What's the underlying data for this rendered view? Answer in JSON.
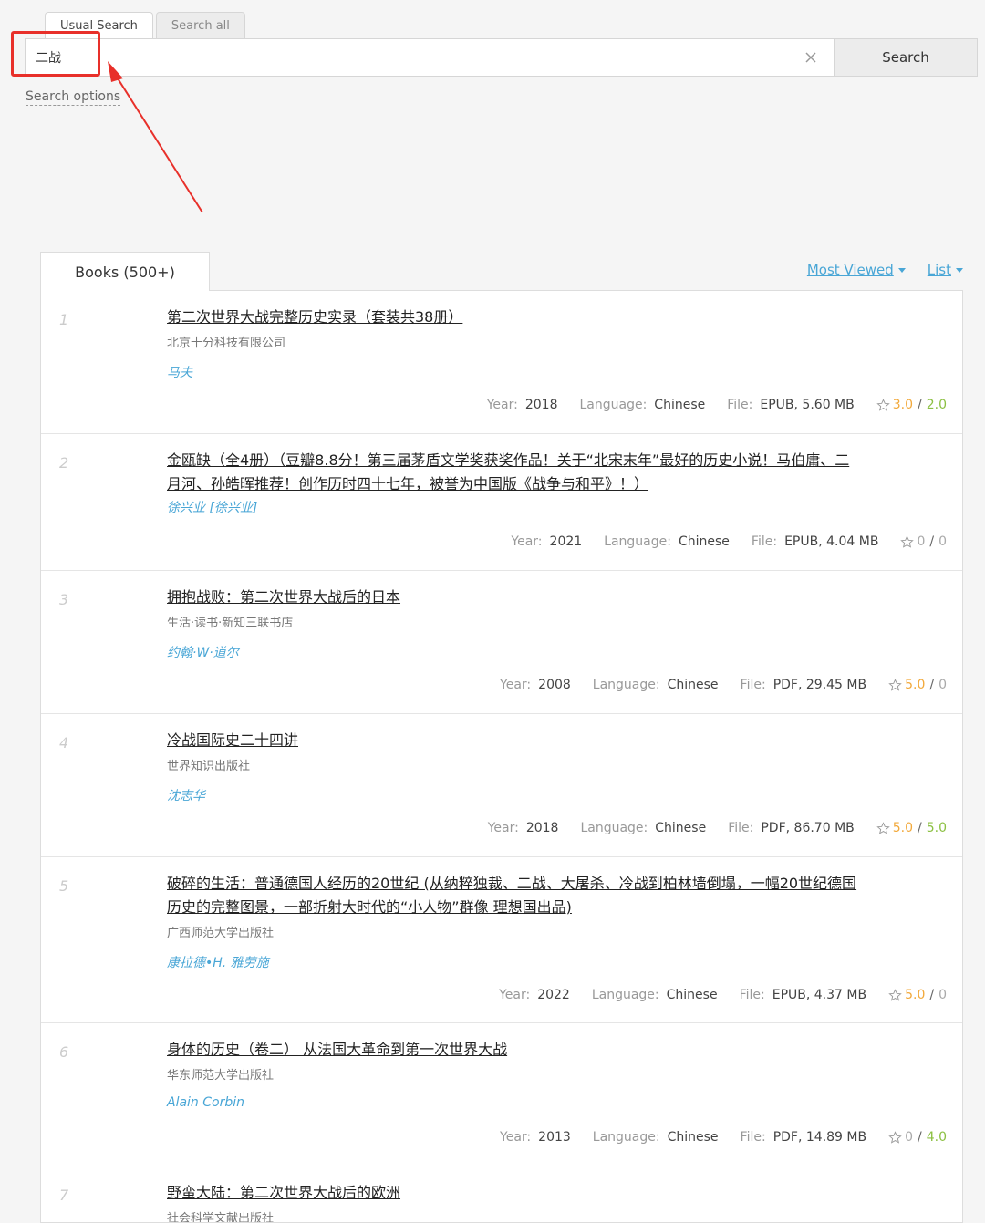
{
  "tabs": [
    "Usual Search",
    "Search all"
  ],
  "search": {
    "value": "二战",
    "button": "Search",
    "options_link": "Search options"
  },
  "results_tab": "Books (500+)",
  "sort": {
    "viewed": "Most Viewed",
    "view_mode": "List"
  },
  "labels": {
    "year": "Year:",
    "language": "Language:",
    "file": "File:"
  },
  "books": [
    {
      "num": "1",
      "title": "第二次世界大战完整历史实录（套装共38册）",
      "publisher": "北京十分科技有限公司",
      "author": "马夫",
      "year": "2018",
      "language": "Chinese",
      "file": "EPUB, 5.60 MB",
      "rating_a": "3.0",
      "rating_b": "2.0"
    },
    {
      "num": "2",
      "title": "金瓯缺（全4册）（豆瓣8.8分！第三届茅盾文学奖获奖作品！关于“北宋末年”最好的历史小说！马伯庸、二月河、孙皓晖推荐！创作历时四十七年，被誉为中国版《战争与和平》！）",
      "publisher": "",
      "author": "徐兴业 [徐兴业]",
      "year": "2021",
      "language": "Chinese",
      "file": "EPUB, 4.04 MB",
      "rating_a": "0",
      "rating_b": "0"
    },
    {
      "num": "3",
      "title": "拥抱战败：第二次世界大战后的日本",
      "publisher": "生活·读书·新知三联书店",
      "author": "约翰·W·道尔",
      "year": "2008",
      "language": "Chinese",
      "file": "PDF, 29.45 MB",
      "rating_a": "5.0",
      "rating_b": "0"
    },
    {
      "num": "4",
      "title": "冷战国际史二十四讲",
      "publisher": "世界知识出版社",
      "author": "沈志华",
      "year": "2018",
      "language": "Chinese",
      "file": "PDF, 86.70 MB",
      "rating_a": "5.0",
      "rating_b": "5.0"
    },
    {
      "num": "5",
      "title": "破碎的生活：普通德国人经历的20世纪 (从纳粹独裁、二战、大屠杀、冷战到柏林墙倒塌，一幅20世纪德国历史的完整图景，一部折射大时代的“小人物”群像 理想国出品)",
      "publisher": "广西师范大学出版社",
      "author": "康拉德•H. 雅劳施",
      "year": "2022",
      "language": "Chinese",
      "file": "EPUB, 4.37 MB",
      "rating_a": "5.0",
      "rating_b": "0"
    },
    {
      "num": "6",
      "title": "身体的历史（卷二） 从法国大革命到第一次世界大战",
      "publisher": "华东师范大学出版社",
      "author": "Alain Corbin",
      "year": "2013",
      "language": "Chinese",
      "file": "PDF, 14.89 MB",
      "rating_a": "0",
      "rating_b": "4.0"
    },
    {
      "num": "7",
      "title": "野蛮大陆：第二次世界大战后的欧洲",
      "publisher": "社会科学文献出版社",
      "author": "",
      "year": "",
      "language": "",
      "file": "",
      "rating_a": "",
      "rating_b": ""
    }
  ]
}
